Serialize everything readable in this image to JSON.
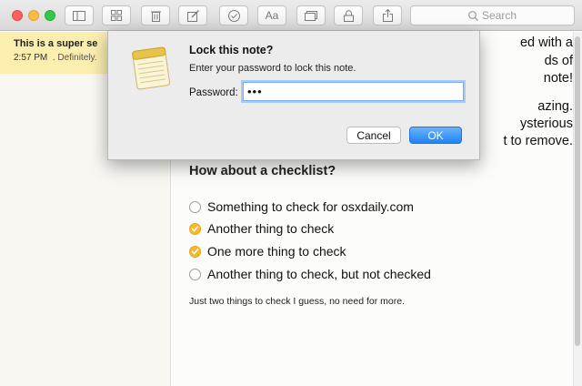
{
  "search": {
    "placeholder": "Search"
  },
  "toolbar": {
    "font_button_label": "Aa"
  },
  "sidebar": {
    "note": {
      "title": "This is a super se",
      "time": "2:57 PM",
      "preview": ". Definitely."
    }
  },
  "note_body": {
    "obscured_lines": [
      "ed with a",
      "ds of",
      "note!",
      "azing.",
      "ysterious",
      "t to remove."
    ],
    "checklist_heading": "How about a checklist?",
    "checklist": [
      {
        "text": "Something to check for osxdaily.com",
        "checked": false
      },
      {
        "text": "Another thing to check",
        "checked": true
      },
      {
        "text": "One more thing to check",
        "checked": true
      },
      {
        "text": "Another thing to check, but not checked",
        "checked": false
      }
    ],
    "footer": "Just two things to check I guess, no need for more."
  },
  "dialog": {
    "title": "Lock this note?",
    "message": "Enter your password to lock this note.",
    "password_label": "Password:",
    "password_value": "•••",
    "cancel_label": "Cancel",
    "ok_label": "OK"
  },
  "colors": {
    "accent": "#1f84f4",
    "check": "#f6b92e",
    "note_highlight": "#fbeeae"
  }
}
